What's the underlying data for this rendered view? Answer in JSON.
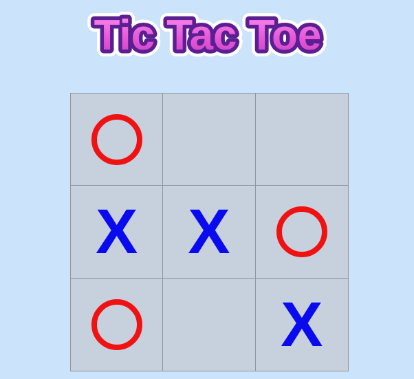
{
  "title": "Tic Tac Toe",
  "colors": {
    "background": "#cbe3fb",
    "board": "#c6d1dd",
    "x": "#0a0aee",
    "o": "#f01212",
    "title_fill": "#e859d6",
    "title_outline": "#5b1f91"
  },
  "board": [
    [
      "O",
      "",
      ""
    ],
    [
      "X",
      "X",
      "O"
    ],
    [
      "O",
      "",
      "X"
    ]
  ]
}
